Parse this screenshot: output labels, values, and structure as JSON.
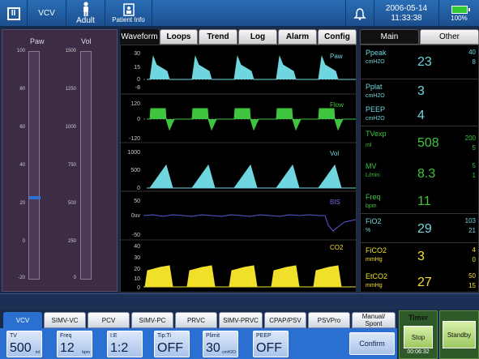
{
  "topbar": {
    "menu_glyph": "II",
    "mode": "VCV",
    "patient_type": "Adult",
    "patient_info": "Patient Info",
    "date": "2006-05-14",
    "time": "11:33:38",
    "battery": "100%",
    "icons": {
      "menu": "menu-icon",
      "person": "person-icon",
      "patient": "patient-info-icon",
      "alarm": "bell-icon",
      "battery": "battery-icon"
    }
  },
  "bars": {
    "paw_label": "Paw",
    "vol_label": "Vol",
    "paw_scale": [
      "100",
      "80",
      "60",
      "40",
      "20",
      "0",
      "-20"
    ],
    "vol_scale": [
      "1500",
      "1250",
      "1000",
      "750",
      "500",
      "250",
      "0"
    ],
    "paw_level": 23,
    "paw_range": [
      -20,
      100
    ],
    "mark_color": "#2e6fd0"
  },
  "wave_tabs": [
    "Waveform",
    "Loops",
    "Trend",
    "Log",
    "Alarm",
    "Config"
  ],
  "waveforms": [
    {
      "label": "Paw",
      "ticks": [
        "30",
        "15",
        "0",
        "-8"
      ],
      "color": "#6fd6df"
    },
    {
      "label": "Flow",
      "ticks": [
        "120",
        "0",
        "-120"
      ],
      "color": "#3ec43e"
    },
    {
      "label": "Vol",
      "ticks": [
        "1000",
        "500",
        "0"
      ],
      "color": "#6fd6df"
    },
    {
      "label": "BIS",
      "ticks": [
        "50",
        "0uv",
        "-50"
      ],
      "color": "#5a5ad6"
    },
    {
      "label": "CO2",
      "ticks": [
        "40",
        "30",
        "20",
        "10",
        "0"
      ],
      "color": "#f0e02a"
    }
  ],
  "numeric_tabs": [
    "Main",
    "Other"
  ],
  "params": [
    {
      "name": "Ppeak",
      "unit": "cmH2O",
      "value": "23",
      "hi": "40",
      "lo": "8",
      "color": "#6fd6df"
    },
    {
      "name": "Pplat",
      "unit": "cmH2O",
      "value": "3",
      "hi": "",
      "lo": "",
      "color": "#6fd6df"
    },
    {
      "name": "PEEP",
      "unit": "cmH2O",
      "value": "4",
      "hi": "",
      "lo": "",
      "color": "#6fd6df"
    },
    {
      "name": "TVexp",
      "unit": "ml",
      "value": "508",
      "hi": "200",
      "lo": "5",
      "color": "#3ec43e"
    },
    {
      "name": "MV",
      "unit": "L/min",
      "value": "8.3",
      "hi": "5",
      "lo": "1",
      "color": "#3ec43e"
    },
    {
      "name": "Freq",
      "unit": "bpm",
      "value": "11",
      "hi": "",
      "lo": "",
      "color": "#3ec43e"
    },
    {
      "name": "FiO2",
      "unit": "%",
      "value": "29",
      "hi": "103",
      "lo": "21",
      "color": "#6fd6df"
    },
    {
      "name": "FiCO2",
      "unit": "mmHg",
      "value": "3",
      "hi": "4",
      "lo": "0",
      "color": "#f0e02a"
    },
    {
      "name": "EtCO2",
      "unit": "mmHg",
      "value": "27",
      "hi": "50",
      "lo": "15",
      "color": "#f0e02a"
    }
  ],
  "mode_tabs": [
    "VCV",
    "SIMV-VC",
    "PCV",
    "SIMV-PC",
    "PRVC",
    "SIMV-PRVC",
    "CPAP/PSV",
    "PSVPro",
    "Manual/\nSpont"
  ],
  "settings": [
    {
      "label": "TV",
      "value": "500",
      "unit": "ml"
    },
    {
      "label": "Freq",
      "value": "12",
      "unit": "bpm"
    },
    {
      "label": "I:E",
      "value": "1:2",
      "unit": ""
    },
    {
      "label": "Tip:Ti",
      "value": "OFF",
      "unit": ""
    },
    {
      "label": "Plimit",
      "value": "30",
      "unit": "cmH2O"
    },
    {
      "label": "PEEP",
      "value": "OFF",
      "unit": ""
    }
  ],
  "confirm_label": "Confirm",
  "timer": {
    "label": "Timer",
    "button": "Stop",
    "value": "00:06:32"
  },
  "standby_label": "Standby"
}
